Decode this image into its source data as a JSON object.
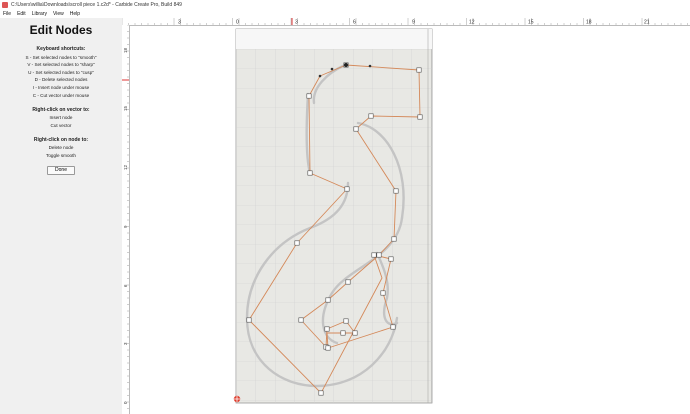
{
  "window": {
    "title": "C:\\Users\\willia\\Downloads\\scroll piece 1.c2d* - Carbide Create Pro, Build 849"
  },
  "menu": [
    "File",
    "Edit",
    "Library",
    "View",
    "Help"
  ],
  "panel": {
    "heading": "Edit Nodes",
    "shortcuts_title": "Keyboard shortcuts:",
    "shortcuts": [
      "S - Set selected nodes to \"smooth\"",
      "V - Set selected nodes to \"sharp\"",
      "U - Set selected nodes to \"cusp\"",
      "D - Delete selected nodes",
      "I - Insert node under mouse",
      "C - Cut vector under mouse"
    ],
    "vector_title": "Right-click on vector to:",
    "vector_items": [
      "Insert node",
      "Cut vector"
    ],
    "node_title": "Right-click on node to:",
    "node_items": [
      "Delete node",
      "Toggle smooth"
    ],
    "done_label": "Done"
  },
  "rulers": {
    "horizontal": [
      "3",
      "0",
      "3",
      "6",
      "9",
      "12",
      "15",
      "18",
      "21"
    ],
    "vertical": [
      "18",
      "15",
      "12",
      "9",
      "6",
      "3",
      "0"
    ]
  },
  "colors": {
    "path": "#d4895a",
    "node_fill": "#ffffff",
    "node_stroke": "#555555",
    "guide": "#c4c4c4",
    "grid": "#cfcfcf",
    "sheet": "#e8e8e4"
  }
}
